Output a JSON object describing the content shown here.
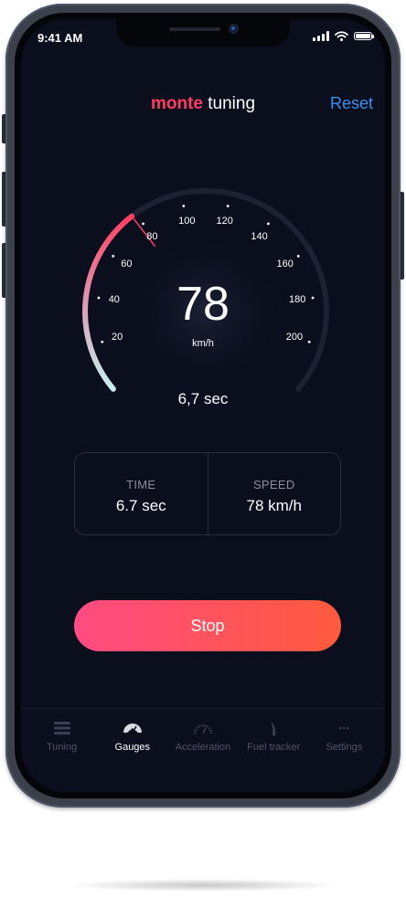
{
  "status_bar": {
    "time": "9:41 AM"
  },
  "header": {
    "brand_part1": "monte",
    "brand_part2": "tuning",
    "reset_label": "Reset"
  },
  "gauge": {
    "speed": "78",
    "unit": "km/h",
    "elapsed": "6,7 sec",
    "current_value": 78,
    "min_value": 0,
    "max_value": 220,
    "ticks": [
      "20",
      "40",
      "60",
      "80",
      "100",
      "120",
      "140",
      "160",
      "180",
      "200"
    ]
  },
  "stats": [
    {
      "label": "TIME",
      "value": "6.7 sec"
    },
    {
      "label": "SPEED",
      "value": "78 km/h"
    }
  ],
  "stop_label": "Stop",
  "tabs": [
    {
      "label": "Tuning",
      "icon": "list-icon"
    },
    {
      "label": "Gauges",
      "icon": "gauge-icon",
      "active": true
    },
    {
      "label": "Acceleration",
      "icon": "speedometer-icon"
    },
    {
      "label": "Fuel tracker",
      "icon": "fuel-icon"
    },
    {
      "label": "Settings",
      "icon": "dots-icon"
    }
  ],
  "colors": {
    "background": "#0b0e1c",
    "accent_red": "#ff3d62",
    "accent_blue": "#3a8ff0",
    "button_start": "#ff4b82",
    "button_end": "#ff5a3c"
  }
}
